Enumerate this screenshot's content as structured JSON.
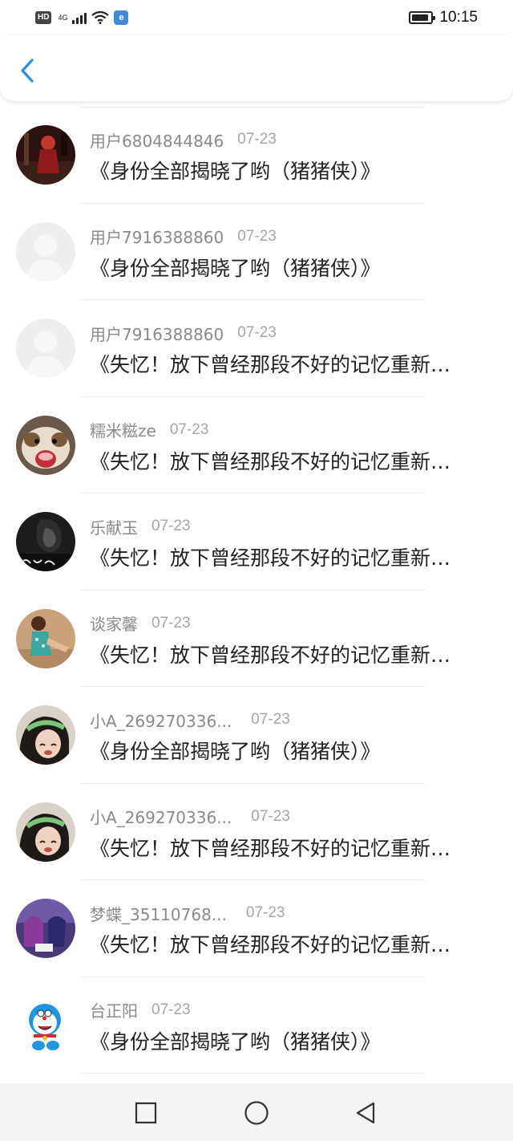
{
  "status_bar": {
    "hd": "HD",
    "network": "4G",
    "app_badge": "е",
    "time": "10:15"
  },
  "header": {
    "back_icon": "chevron-left-icon",
    "accent_color": "#2a8fe0"
  },
  "items": [
    {
      "username": "用户6804844846",
      "date": "07-23",
      "title": "《身份全部揭晓了哟（猪猪侠）》",
      "avatar": "dark-concert-photo"
    },
    {
      "username": "用户7916388860",
      "date": "07-23",
      "title": "《身份全部揭晓了哟（猪猪侠）》",
      "avatar": "default-avatar"
    },
    {
      "username": "用户7916388860",
      "date": "07-23",
      "title": "《失忆！放下曾经那段不好的记忆重新…",
      "avatar": "default-avatar"
    },
    {
      "username": "糯米糍ze",
      "date": "07-23",
      "title": "《失忆！放下曾经那段不好的记忆重新…",
      "avatar": "hamster-photo"
    },
    {
      "username": "乐献玉",
      "date": "07-23",
      "title": "《失忆！放下曾经那段不好的记忆重新…",
      "avatar": "dark-portrait-photo"
    },
    {
      "username": "谈家馨",
      "date": "07-23",
      "title": "《失忆！放下曾经那段不好的记忆重新…",
      "avatar": "beach-photo"
    },
    {
      "username": "小A_269270336...",
      "date": "07-23",
      "title": "《身份全部揭晓了哟（猪猪侠）》",
      "avatar": "girl-headband-photo"
    },
    {
      "username": "小A_269270336...",
      "date": "07-23",
      "title": "《失忆！放下曾经那段不好的记忆重新…",
      "avatar": "girl-headband-photo"
    },
    {
      "username": "梦蝶_35110768...",
      "date": "07-23",
      "title": "《失忆！放下曾经那段不好的记忆重新…",
      "avatar": "anime-poster-photo"
    },
    {
      "username": "台正阳",
      "date": "07-23",
      "title": "《身份全部揭晓了哟（猪猪侠）》",
      "avatar": "doraemon-cartoon"
    }
  ],
  "nav": {
    "recents_icon": "square-icon",
    "home_icon": "circle-icon",
    "back_icon": "triangle-back-icon"
  }
}
